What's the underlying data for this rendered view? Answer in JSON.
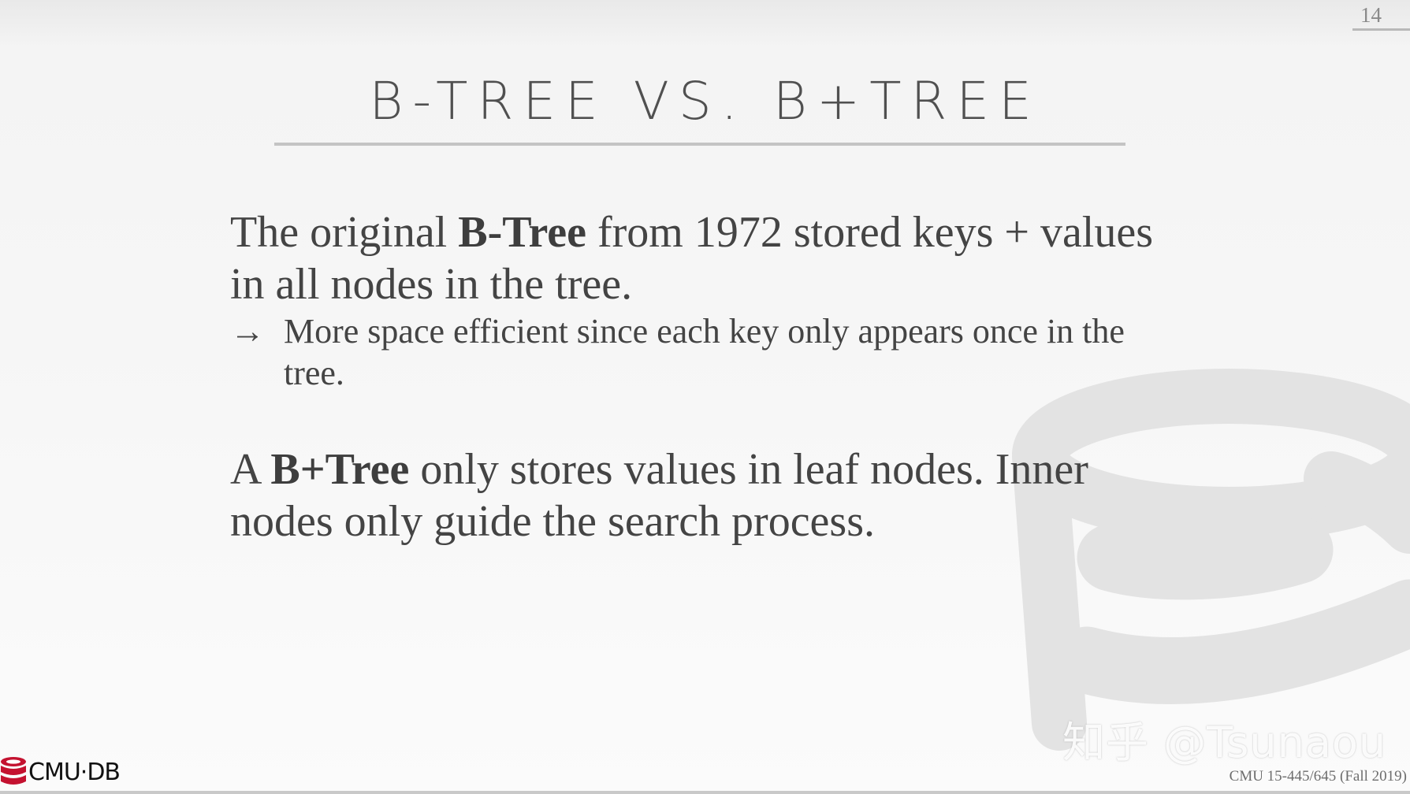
{
  "slide": {
    "page_number": "14",
    "title": "B-TREE VS. B+TREE"
  },
  "paragraph_1": {
    "text_before": "The original ",
    "bold": "B-Tree",
    "text_after": " from 1972 stored keys + values in all nodes in the tree.",
    "sub_bullet": {
      "arrow": "→",
      "text": "More space efficient since each key only appears once in the tree."
    }
  },
  "paragraph_2": {
    "text_before": "A ",
    "bold": "B+Tree",
    "text_after": " only stores values in leaf nodes. Inner nodes only guide the search process."
  },
  "footer": {
    "logo_text": "CMU·DB",
    "course": "CMU 15-445/645 (Fall 2019)",
    "watermark": "知乎 @Tsunaou"
  },
  "colors": {
    "logo_red": "#c41230",
    "text": "#444444"
  }
}
